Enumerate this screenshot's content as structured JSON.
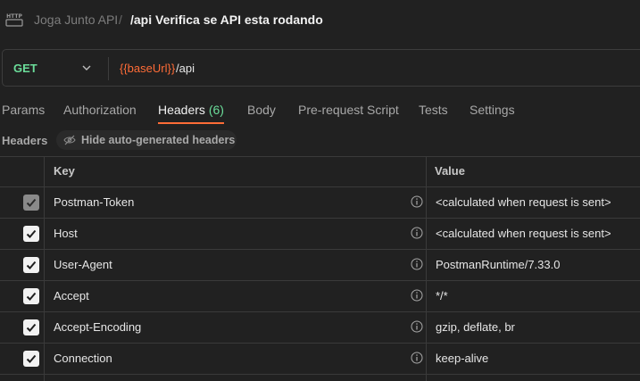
{
  "breadcrumb": {
    "icon_text": "HTTP",
    "parent": "Joga Junto API",
    "separator": "/",
    "title": "/api Verifica se API esta rodando"
  },
  "request": {
    "method": "GET",
    "url_variable": "{{baseUrl}}",
    "url_path": "/api"
  },
  "tabs": [
    {
      "label": "Params"
    },
    {
      "label": "Authorization"
    },
    {
      "label": "Headers",
      "count": "(6)",
      "active": true
    },
    {
      "label": "Body"
    },
    {
      "label": "Pre-request Script"
    },
    {
      "label": "Tests"
    },
    {
      "label": "Settings"
    }
  ],
  "headers_section": {
    "label": "Headers",
    "hide_button": "Hide auto-generated headers"
  },
  "table": {
    "columns": [
      "Key",
      "Value"
    ],
    "rows": [
      {
        "checked": true,
        "disabled": true,
        "key": "Postman-Token",
        "value": "<calculated when request is sent>"
      },
      {
        "checked": true,
        "disabled": false,
        "key": "Host",
        "value": "<calculated when request is sent>"
      },
      {
        "checked": true,
        "disabled": false,
        "key": "User-Agent",
        "value": "PostmanRuntime/7.33.0"
      },
      {
        "checked": true,
        "disabled": false,
        "key": "Accept",
        "value": "*/*"
      },
      {
        "checked": true,
        "disabled": false,
        "key": "Accept-Encoding",
        "value": "gzip, deflate, br"
      },
      {
        "checked": true,
        "disabled": false,
        "key": "Connection",
        "value": "keep-alive"
      }
    ]
  },
  "colors": {
    "background": "#212121",
    "accent": "#ff6c37",
    "method": "#6bdd9a"
  }
}
